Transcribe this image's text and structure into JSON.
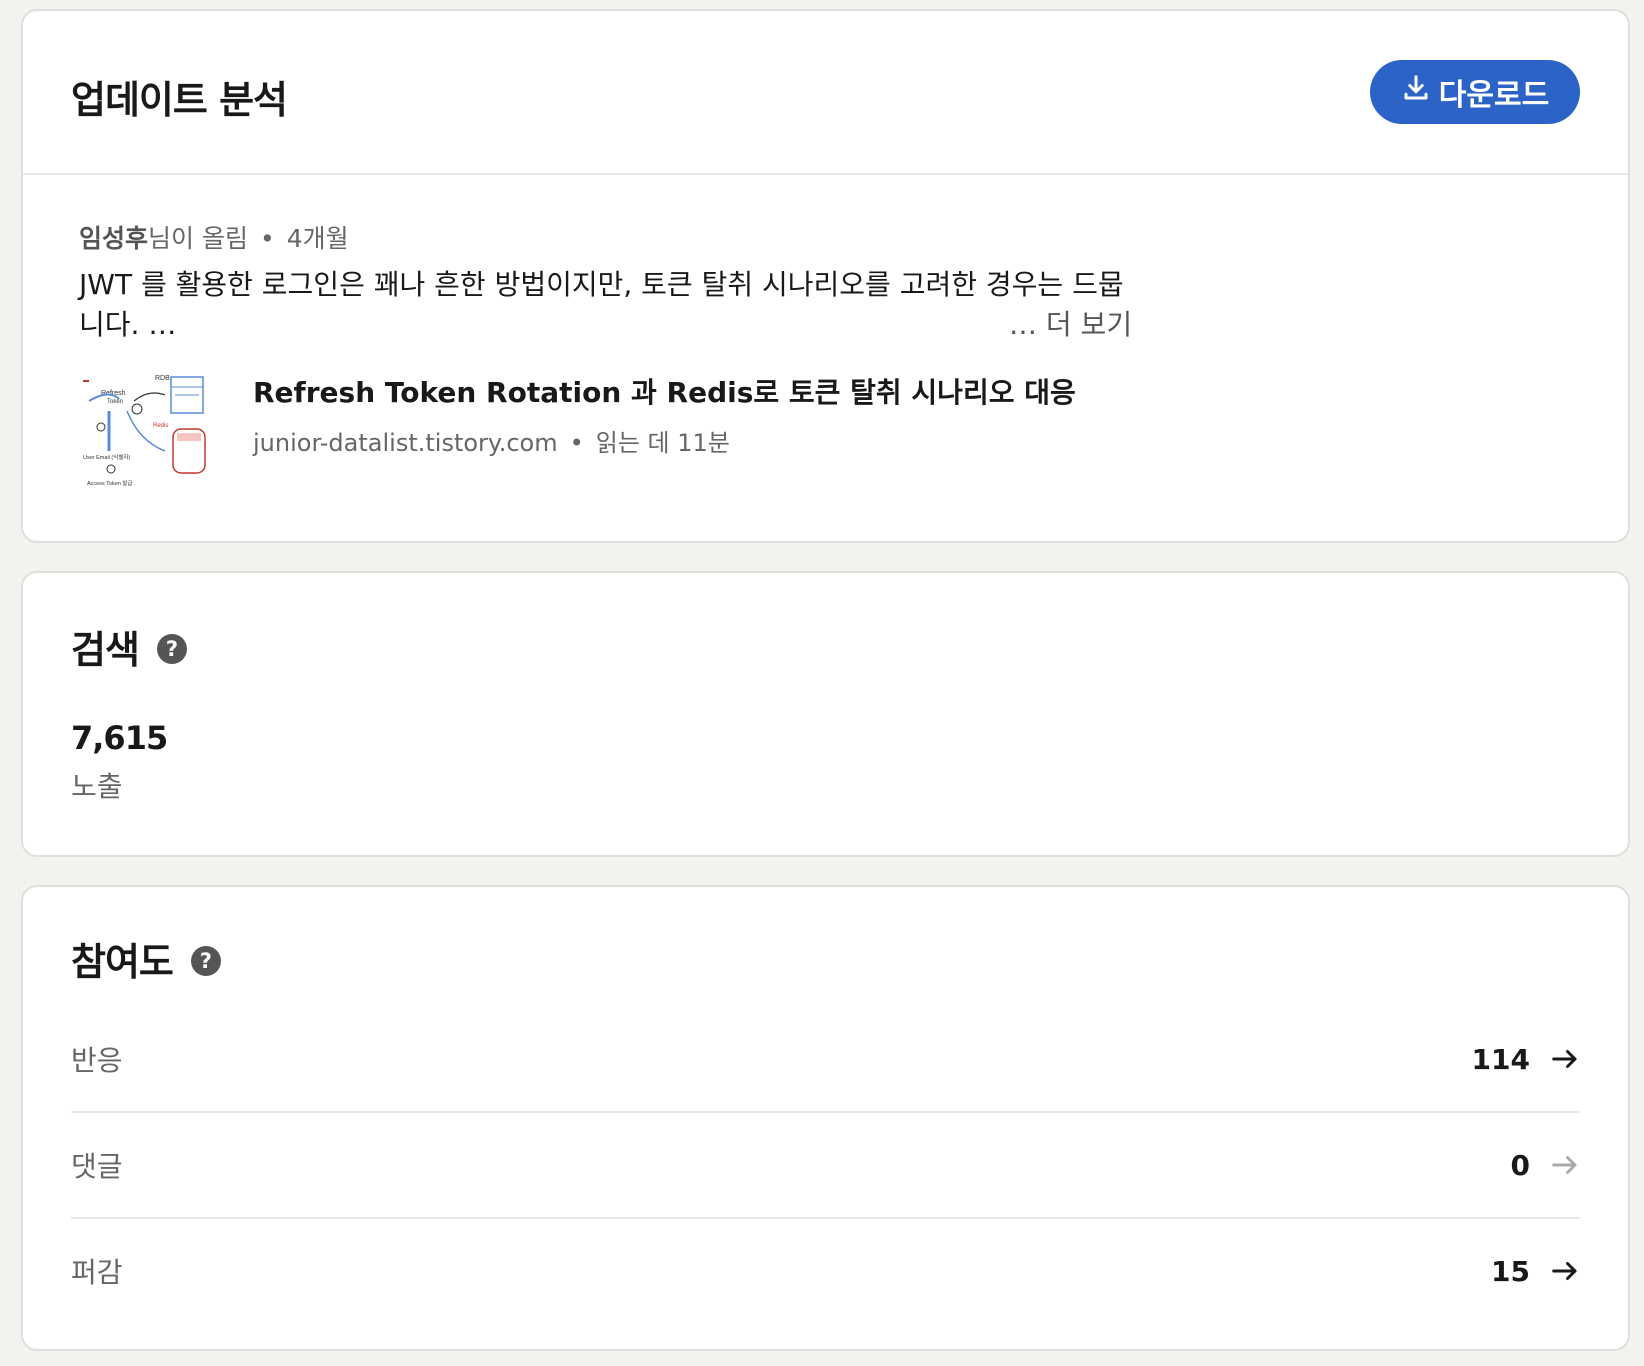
{
  "update": {
    "title": "업데이트 분석",
    "download_label": "다운로드",
    "author": "임성후",
    "author_suffix": "님이 올림",
    "time_ago": "4개월",
    "post_text": "JWT 를 활용한 로그인은 꽤나 흔한 방법이지만, 토큰 탈취 시나리오를 고려한 경우는 드뭅니다. …",
    "see_more": "… 더 보기",
    "link": {
      "title": "Refresh Token Rotation 과 Redis로 토큰 탈취 시나리오 대응",
      "domain": "junior-datalist.tistory.com",
      "read_time": "읽는 데 11분",
      "thumb_labels": {
        "rdb": "RDB",
        "refresh": "Refresh",
        "token": "Token",
        "redis": "Redis",
        "user_email": "User Email (식별자)",
        "access_token": "Access Token 발급"
      }
    }
  },
  "search": {
    "title": "검색",
    "help": "?",
    "value": "7,615",
    "label": "노출"
  },
  "engagement": {
    "title": "참여도",
    "help": "?",
    "rows": [
      {
        "label": "반응",
        "value": "114",
        "arrow_color": "#191919"
      },
      {
        "label": "댓글",
        "value": "0",
        "arrow_color": "#aaaaaa"
      },
      {
        "label": "퍼감",
        "value": "15",
        "arrow_color": "#191919"
      }
    ]
  },
  "colors": {
    "accent": "#2b63c6",
    "background": "#f4f2ee",
    "card": "#ffffff"
  }
}
